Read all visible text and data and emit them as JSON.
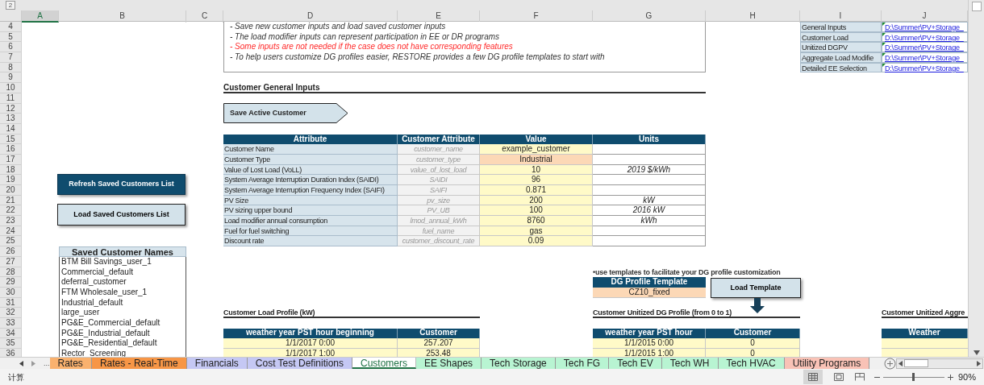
{
  "outline_button": "2",
  "columns": [
    {
      "label": "A",
      "selected": true
    },
    {
      "label": "B",
      "selected": false
    },
    {
      "label": "C",
      "selected": false
    },
    {
      "label": "D",
      "selected": false
    },
    {
      "label": "E",
      "selected": false
    },
    {
      "label": "F",
      "selected": false
    },
    {
      "label": "G",
      "selected": false
    },
    {
      "label": "H",
      "selected": false
    },
    {
      "label": "I",
      "selected": false
    },
    {
      "label": "J",
      "selected": false
    }
  ],
  "rows": [
    "4",
    "5",
    "6",
    "7",
    "8",
    "9",
    "10",
    "11",
    "12",
    "13",
    "14",
    "15",
    "16",
    "17",
    "18",
    "19",
    "20",
    "21",
    "22",
    "23",
    "24",
    "25",
    "26",
    "27",
    "28",
    "29",
    "30",
    "31",
    "32",
    "33",
    "34",
    "35",
    "36"
  ],
  "notes": [
    {
      "text": "- Save new customer inputs and load saved customer inputs",
      "kind": "normal"
    },
    {
      "text": "- The load modifier inputs can represent participation in EE or DR programs",
      "kind": "normal"
    },
    {
      "text": "- Some inputs are not needed if the case does not have corresponding features",
      "kind": "warning"
    },
    {
      "text": "- To help users customize DG profiles easier, RESTORE provides a few DG profile templates to start with",
      "kind": "normal"
    }
  ],
  "links": [
    {
      "label": "General Inputs",
      "path": "D:\\Summer\\PV+Storage_"
    },
    {
      "label": "Customer Load",
      "path": "D:\\Summer\\PV+Storage_"
    },
    {
      "label": "Unitized DGPV",
      "path": "D:\\Summer\\PV+Storage_"
    },
    {
      "label": "Aggregate Load Modifie",
      "path": "D:\\Summer\\PV+Storage_"
    },
    {
      "label": "Detailed EE Selection",
      "path": "D:\\Summer\\PV+Storage_"
    }
  ],
  "general_inputs": {
    "heading": "Customer General Inputs",
    "save_button": "Save Active Customer",
    "columns": [
      "Attribute",
      "Customer Attribute",
      "Value",
      "Units"
    ],
    "rows": [
      {
        "attribute": "Customer Name",
        "name": "customer_name",
        "value": "example_customer",
        "kind": "input"
      },
      {
        "attribute": "Customer Type",
        "name": "customer_type",
        "value": "Industrial",
        "kind": "dropdown"
      },
      {
        "attribute": "Value of Lost Load (VoLL)",
        "name": "value_of_lost_load",
        "value": "10",
        "kind": "input",
        "units": "2019 $/kWh"
      },
      {
        "attribute": "System Average Interruption Duration Index (SAIDI)",
        "name": "SAIDI",
        "value": "96",
        "kind": "input"
      },
      {
        "attribute": "System Average Interruption Frequency Index (SAIFI)",
        "name": "SAIFI",
        "value": "0.871",
        "kind": "input"
      },
      {
        "attribute": "PV Size",
        "name": "pv_size",
        "value": "200",
        "kind": "input",
        "units": "kW"
      },
      {
        "attribute": "PV sizing upper bound",
        "name": "PV_UB",
        "value": "100",
        "kind": "input",
        "units": "2016 kW"
      },
      {
        "attribute": "Load modifier annual consumption",
        "name": "lmod_annual_kWh",
        "value": "8760",
        "kind": "input",
        "units": "kWh"
      },
      {
        "attribute": "Fuel for fuel switching",
        "name": "fuel_name",
        "value": "gas",
        "kind": "input"
      },
      {
        "attribute": "Discount rate",
        "name": "customer_discount_rate",
        "value": "0.09",
        "kind": "input"
      }
    ]
  },
  "saved_customers": {
    "refresh_button": "Refresh Saved Customers List",
    "load_button": "Load Saved Customers List",
    "header": "Saved Customer Names",
    "items": [
      "BTM Bill Savings_user_1",
      "Commercial_default",
      "deferral_customer",
      "FTM Wholesale_user_1",
      "Industrial_default",
      "large_user",
      "PG&E_Commercial_default",
      "PG&E_Industrial_default",
      "PG&E_Residential_default",
      "Rector_Screening"
    ]
  },
  "dg_template": {
    "note": "•use templates to facilitate your DG profile customization",
    "header": "DG Profile Template",
    "value": "CZ10_fixed",
    "button": "Load Template"
  },
  "load_profile": {
    "heading": "Customer Load Profile (kW)",
    "columns": [
      "weather year PST hour beginning",
      "Customer"
    ],
    "rows": [
      [
        "1/1/2017 0:00",
        "257.207"
      ],
      [
        "1/1/2017 1:00",
        "253.48"
      ]
    ]
  },
  "dg_profile": {
    "heading": "Customer Unitized DG Profile (from 0 to 1)",
    "columns": [
      "weather year PST hour",
      "Customer"
    ],
    "rows": [
      [
        "1/1/2015 0:00",
        "0"
      ],
      [
        "1/1/2015 1:00",
        "0"
      ]
    ]
  },
  "aggregate_profile": {
    "heading": "Customer Unitized Aggre",
    "columns": [
      "Weather"
    ]
  },
  "sheet_nav": {
    "more": "..."
  },
  "sheet_tabs": [
    {
      "label": "Rates",
      "color": "#f9b16e",
      "selected": false
    },
    {
      "label": "Rates - Real-Time",
      "color": "#f79646",
      "selected": false
    },
    {
      "label": "Financials",
      "color": "#c5c8f4",
      "selected": false
    },
    {
      "label": "Cost Test Definitions",
      "color": "#c5c8f4",
      "selected": false
    },
    {
      "label": "Customers",
      "color": "#ffffff",
      "selected": true
    },
    {
      "label": "EE Shapes",
      "color": "#b8f4d2",
      "selected": false
    },
    {
      "label": "Tech Storage",
      "color": "#b8f4d2",
      "selected": false
    },
    {
      "label": "Tech FG",
      "color": "#b8f4d2",
      "selected": false
    },
    {
      "label": "Tech EV",
      "color": "#b8f4d2",
      "selected": false
    },
    {
      "label": "Tech WH",
      "color": "#b8f4d2",
      "selected": false
    },
    {
      "label": "Tech HVAC",
      "color": "#b8f4d2",
      "selected": false
    },
    {
      "label": "Utility Programs",
      "color": "#f9c2b6",
      "selected": false
    }
  ],
  "status_bar": {
    "mode": "计算",
    "zoom": "90%",
    "level": 0.5
  }
}
